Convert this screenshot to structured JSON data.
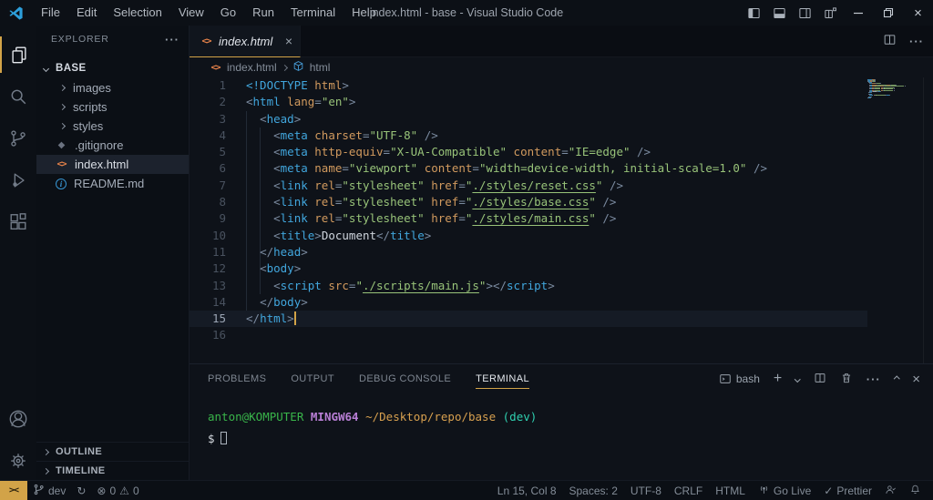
{
  "window": {
    "title": "index.html - base - Visual Studio Code",
    "menus": [
      "File",
      "Edit",
      "Selection",
      "View",
      "Go",
      "Run",
      "Terminal",
      "Help"
    ]
  },
  "activity_bar": {
    "top_icons": [
      "files-icon",
      "search-icon",
      "source-control-icon",
      "run-debug-icon",
      "extensions-icon"
    ],
    "active": "files-icon",
    "bottom_icons": [
      "account-icon",
      "settings-gear-icon"
    ]
  },
  "sidebar": {
    "header": "EXPLORER",
    "root_folder": "BASE",
    "items": [
      {
        "label": "images",
        "kind": "folder"
      },
      {
        "label": "scripts",
        "kind": "folder"
      },
      {
        "label": "styles",
        "kind": "folder"
      },
      {
        "label": ".gitignore",
        "kind": "gitignore"
      },
      {
        "label": "index.html",
        "kind": "html",
        "selected": true
      },
      {
        "label": "README.md",
        "kind": "info"
      }
    ],
    "bottom_sections": [
      "OUTLINE",
      "TIMELINE"
    ]
  },
  "editor": {
    "tab": {
      "label": "index.html",
      "icon": "html-code-icon",
      "close": "×"
    },
    "breadcrumb": {
      "file": "index.html",
      "symbol": "html"
    },
    "active_line": 15,
    "cursor_after_line": 15,
    "lines": [
      [
        [
          "<!DOCTYPE",
          "t"
        ],
        [
          " ",
          "w"
        ],
        [
          "html",
          "a"
        ],
        [
          ">",
          "p"
        ]
      ],
      [
        [
          "<",
          "p"
        ],
        [
          "html",
          "t"
        ],
        [
          " ",
          "w"
        ],
        [
          "lang",
          "a"
        ],
        [
          "=",
          "p"
        ],
        [
          "\"en\"",
          "s"
        ],
        [
          ">",
          "p"
        ]
      ],
      [
        [
          "  ",
          "w"
        ],
        [
          "<",
          "p"
        ],
        [
          "head",
          "t"
        ],
        [
          ">",
          "p"
        ]
      ],
      [
        [
          "    ",
          "w"
        ],
        [
          "<",
          "p"
        ],
        [
          "meta",
          "t"
        ],
        [
          " ",
          "w"
        ],
        [
          "charset",
          "a"
        ],
        [
          "=",
          "p"
        ],
        [
          "\"UTF-8\"",
          "s"
        ],
        [
          " ",
          "w"
        ],
        [
          "/>",
          "p"
        ]
      ],
      [
        [
          "    ",
          "w"
        ],
        [
          "<",
          "p"
        ],
        [
          "meta",
          "t"
        ],
        [
          " ",
          "w"
        ],
        [
          "http-equiv",
          "a"
        ],
        [
          "=",
          "p"
        ],
        [
          "\"X-UA-Compatible\"",
          "s"
        ],
        [
          " ",
          "w"
        ],
        [
          "content",
          "a"
        ],
        [
          "=",
          "p"
        ],
        [
          "\"IE=edge\"",
          "s"
        ],
        [
          " ",
          "w"
        ],
        [
          "/>",
          "p"
        ]
      ],
      [
        [
          "    ",
          "w"
        ],
        [
          "<",
          "p"
        ],
        [
          "meta",
          "t"
        ],
        [
          " ",
          "w"
        ],
        [
          "name",
          "a"
        ],
        [
          "=",
          "p"
        ],
        [
          "\"viewport\"",
          "s"
        ],
        [
          " ",
          "w"
        ],
        [
          "content",
          "a"
        ],
        [
          "=",
          "p"
        ],
        [
          "\"width=device-width, initial-scale=1.0\"",
          "s"
        ],
        [
          " ",
          "w"
        ],
        [
          "/>",
          "p"
        ]
      ],
      [
        [
          "    ",
          "w"
        ],
        [
          "<",
          "p"
        ],
        [
          "link",
          "t"
        ],
        [
          " ",
          "w"
        ],
        [
          "rel",
          "a"
        ],
        [
          "=",
          "p"
        ],
        [
          "\"stylesheet\"",
          "s"
        ],
        [
          " ",
          "w"
        ],
        [
          "href",
          "a"
        ],
        [
          "=",
          "p"
        ],
        [
          "\"",
          "s"
        ],
        [
          "./styles/reset.css",
          "u"
        ],
        [
          "\"",
          "s"
        ],
        [
          " ",
          "w"
        ],
        [
          "/>",
          "p"
        ]
      ],
      [
        [
          "    ",
          "w"
        ],
        [
          "<",
          "p"
        ],
        [
          "link",
          "t"
        ],
        [
          " ",
          "w"
        ],
        [
          "rel",
          "a"
        ],
        [
          "=",
          "p"
        ],
        [
          "\"stylesheet\"",
          "s"
        ],
        [
          " ",
          "w"
        ],
        [
          "href",
          "a"
        ],
        [
          "=",
          "p"
        ],
        [
          "\"",
          "s"
        ],
        [
          "./styles/base.css",
          "u"
        ],
        [
          "\"",
          "s"
        ],
        [
          " ",
          "w"
        ],
        [
          "/>",
          "p"
        ]
      ],
      [
        [
          "    ",
          "w"
        ],
        [
          "<",
          "p"
        ],
        [
          "link",
          "t"
        ],
        [
          " ",
          "w"
        ],
        [
          "rel",
          "a"
        ],
        [
          "=",
          "p"
        ],
        [
          "\"stylesheet\"",
          "s"
        ],
        [
          " ",
          "w"
        ],
        [
          "href",
          "a"
        ],
        [
          "=",
          "p"
        ],
        [
          "\"",
          "s"
        ],
        [
          "./styles/main.css",
          "u"
        ],
        [
          "\"",
          "s"
        ],
        [
          " ",
          "w"
        ],
        [
          "/>",
          "p"
        ]
      ],
      [
        [
          "    ",
          "w"
        ],
        [
          "<",
          "p"
        ],
        [
          "title",
          "t"
        ],
        [
          ">",
          "p"
        ],
        [
          "Document",
          "x"
        ],
        [
          "</",
          "p"
        ],
        [
          "title",
          "t"
        ],
        [
          ">",
          "p"
        ]
      ],
      [
        [
          "  ",
          "w"
        ],
        [
          "</",
          "p"
        ],
        [
          "head",
          "t"
        ],
        [
          ">",
          "p"
        ]
      ],
      [
        [
          "  ",
          "w"
        ],
        [
          "<",
          "p"
        ],
        [
          "body",
          "t"
        ],
        [
          ">",
          "p"
        ]
      ],
      [
        [
          "    ",
          "w"
        ],
        [
          "<",
          "p"
        ],
        [
          "script",
          "t"
        ],
        [
          " ",
          "w"
        ],
        [
          "src",
          "a"
        ],
        [
          "=",
          "p"
        ],
        [
          "\"",
          "s"
        ],
        [
          "./scripts/main.js",
          "u"
        ],
        [
          "\"",
          "s"
        ],
        [
          ">",
          "p"
        ],
        [
          "</",
          "p"
        ],
        [
          "script",
          "t"
        ],
        [
          ">",
          "p"
        ]
      ],
      [
        [
          "  ",
          "w"
        ],
        [
          "</",
          "p"
        ],
        [
          "body",
          "t"
        ],
        [
          ">",
          "p"
        ]
      ],
      [
        [
          "</",
          "p"
        ],
        [
          "html",
          "t"
        ],
        [
          ">",
          "p"
        ]
      ],
      []
    ]
  },
  "panel": {
    "tabs": [
      "PROBLEMS",
      "OUTPUT",
      "DEBUG CONSOLE",
      "TERMINAL"
    ],
    "active_tab": "TERMINAL",
    "shell_label": "bash",
    "terminal": {
      "prompt_user": "anton@KOMPUTER",
      "prompt_env": "MINGW64",
      "prompt_path": "~/Desktop/repo/base",
      "prompt_branch": "(dev)",
      "prompt_char": "$"
    }
  },
  "status_bar": {
    "remote_indicator": "><",
    "branch": "dev",
    "errors": "0",
    "warnings": "0",
    "right_items": [
      {
        "label": "Ln 15, Col 8"
      },
      {
        "label": "Spaces: 2"
      },
      {
        "label": "UTF-8"
      },
      {
        "label": "CRLF"
      },
      {
        "label": "HTML"
      },
      {
        "icon": "broadcast-icon",
        "label": "Go Live"
      },
      {
        "icon": "check-icon",
        "label": "Prettier"
      },
      {
        "icon": "feedback-icon",
        "label": ""
      },
      {
        "icon": "bell-icon",
        "label": ""
      }
    ]
  },
  "colors": {
    "accent": "#d2a348",
    "tag": "#41a6dd",
    "attr": "#d19a5e",
    "string": "#98c379",
    "punct": "#7b8ba0",
    "text": "#cfd5dd",
    "term_user": "#39b54a",
    "term_env": "#b97fd6",
    "term_path": "#d7a04f",
    "term_branch": "#2fd0b0"
  }
}
